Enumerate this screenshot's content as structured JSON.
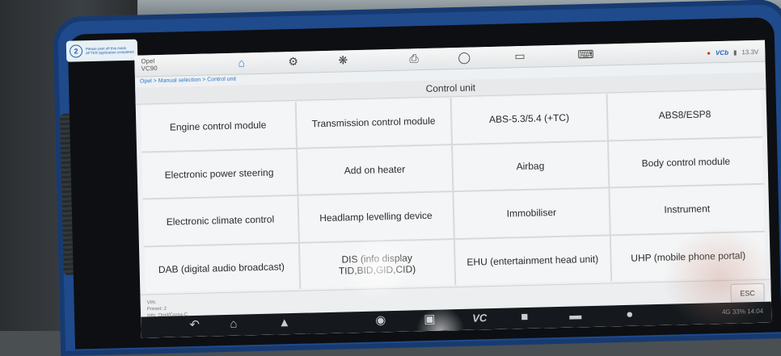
{
  "sticker": {
    "number": "2",
    "text": "Please peel off this mask AFTER application completed"
  },
  "header": {
    "vehicle_make": "Opel",
    "vehicle_code": "VC90",
    "icons": [
      "home-icon",
      "car-lift-icon",
      "gear-icon",
      "print-icon",
      "help-icon",
      "folder-icon",
      "keyboard-icon"
    ],
    "status_vcb": "VCb",
    "status_voltage": "13.3V"
  },
  "breadcrumb": "Opel > Manual selection > Control unit",
  "page_title": "Control unit",
  "control_units": [
    "Engine control module",
    "Transmission control module",
    "ABS-5.3/5.4 (+TC)",
    "ABS8/ESP8",
    "Electronic power steering",
    "Add on heater",
    "Airbag",
    "Body control module",
    "Electronic climate control",
    "Headlamp levelling device",
    "Immobiliser",
    "Instrument",
    "DAB (digital audio broadcast)",
    "DIS (info display TID,BID,GID,CID)",
    "EHU (entertainment head unit)",
    "UHP (mobile phone portal)"
  ],
  "footer": {
    "vin": "VIN:",
    "preset": "Preset: 2",
    "info": "Info: Opel/Corsa-C",
    "esc_label": "ESC"
  },
  "navbar": {
    "icons": [
      "back-icon",
      "home-icon",
      "car-icon",
      "camera-icon",
      "screen-mirror-icon",
      "vci-icon",
      "car-lift-icon",
      "car-scan-icon",
      "car-wrench-icon"
    ],
    "vc_label": "VC",
    "status": "4G 33% 14:04"
  }
}
